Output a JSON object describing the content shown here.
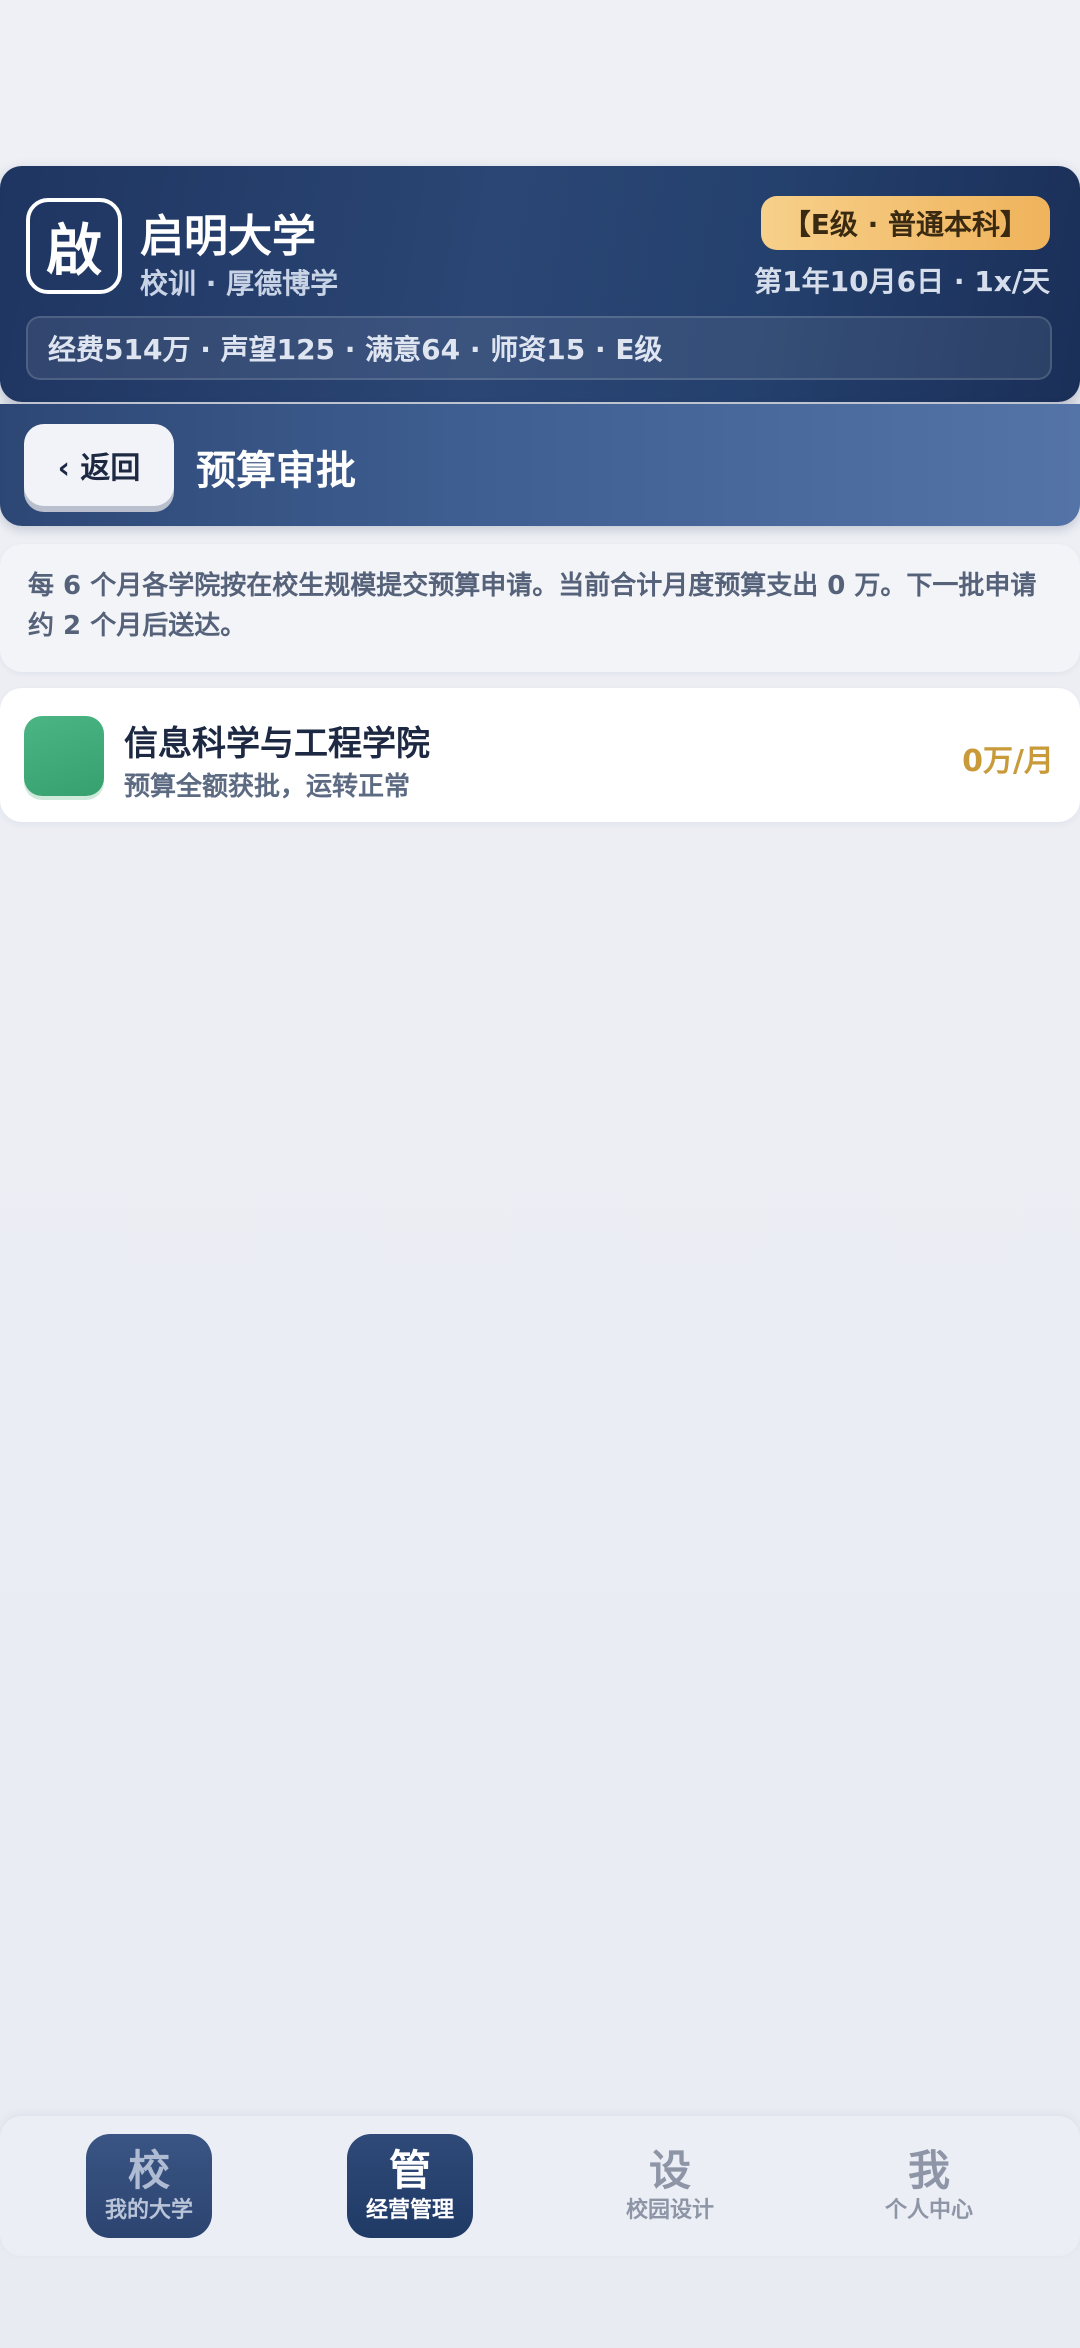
{
  "header": {
    "crest_char": "啟",
    "school_name": "启明大学",
    "motto": "校训 · 厚德博学",
    "rank_badge": "【E级 · 普通本科】",
    "game_date": "第1年10月6日 · 1x/天",
    "stats": "经费514万 · 声望125 · 满意64 · 师资15 · E级"
  },
  "title_bar": {
    "back_label": "‹ 返回",
    "title": "预算审批"
  },
  "info": {
    "text": "每 6 个月各学院按在校生规模提交预算申请。当前合计月度预算支出 0 万。下一批申请约 2 个月后送达。"
  },
  "colleges": [
    {
      "name": "信息科学与工程学院",
      "status": "预算全额获批，运转正常",
      "budget": "0万/月",
      "icon_color": "#3fa977"
    }
  ],
  "nav": [
    {
      "glyph": "校",
      "label": "我的大学"
    },
    {
      "glyph": "管",
      "label": "经营管理"
    },
    {
      "glyph": "设",
      "label": "校园设计"
    },
    {
      "glyph": "我",
      "label": "个人中心"
    }
  ],
  "colors": {
    "header_bg": "#24406d",
    "accent_gold": "#efb35b",
    "budget_text": "#c89a3a",
    "college_icon": "#3fa977"
  }
}
